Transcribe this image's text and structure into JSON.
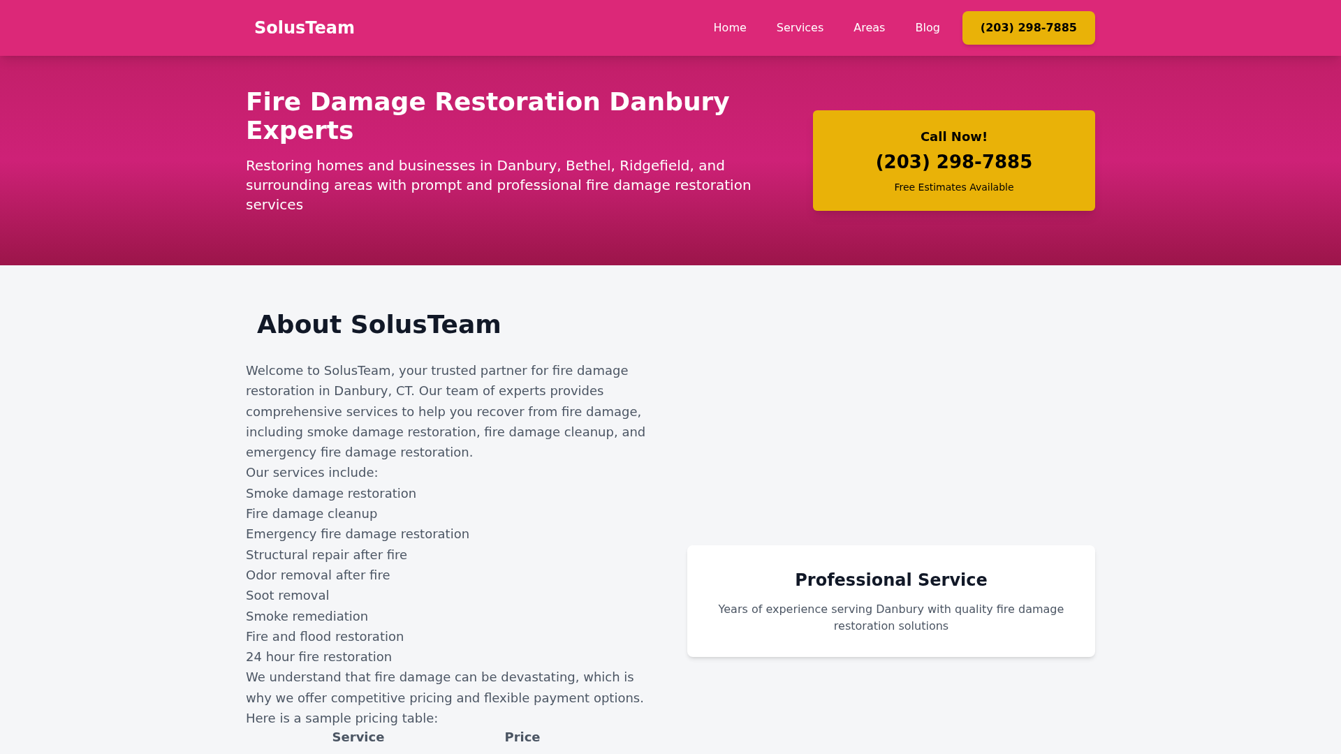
{
  "header": {
    "logo": "SolusTeam",
    "nav": [
      {
        "label": "Home"
      },
      {
        "label": "Services"
      },
      {
        "label": "Areas"
      },
      {
        "label": "Blog"
      }
    ],
    "phone_button": "(203) 298-7885"
  },
  "hero": {
    "title": "Fire Damage Restoration Danbury Experts",
    "subtitle": "Restoring homes and businesses in Danbury, Bethel, Ridgefield, and surrounding areas with prompt and professional fire damage restoration services",
    "call_card": {
      "heading": "Call Now!",
      "phone": "(203) 298-7885",
      "note": "Free Estimates Available"
    }
  },
  "about": {
    "heading": "About SolusTeam",
    "intro": "Welcome to SolusTeam, your trusted partner for fire damage restoration in Danbury, CT. Our team of experts provides comprehensive services to help you recover from fire damage, including smoke damage restoration, fire damage cleanup, and emergency fire damage restoration.",
    "services_intro": "Our services include:",
    "services": [
      "Smoke damage restoration",
      "Fire damage cleanup",
      "Emergency fire damage restoration",
      "Structural repair after fire",
      "Odor removal after fire",
      "Soot removal",
      "Smoke remediation",
      "Fire and flood restoration",
      "24 hour fire restoration"
    ],
    "pricing_text": "We understand that fire damage can be devastating, which is why we offer competitive pricing and flexible payment options.",
    "table_intro": "Here is a sample pricing table:",
    "table": {
      "columns": [
        "Service",
        "Price"
      ]
    },
    "feature_card": {
      "title": "Professional Service",
      "description": "Years of experience serving Danbury with quality fire damage restoration solutions"
    }
  }
}
